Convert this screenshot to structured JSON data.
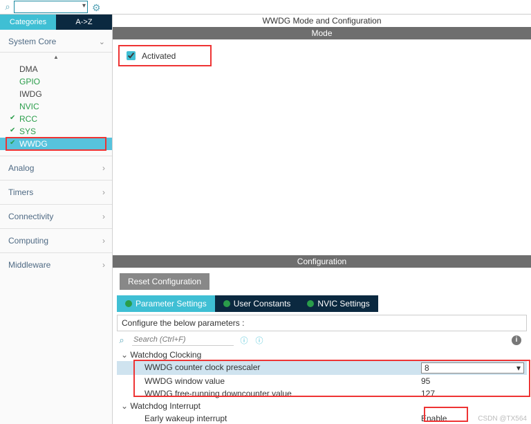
{
  "top": {
    "search_value": "",
    "search_placeholder": ""
  },
  "sidebar": {
    "tab_categories": "Categories",
    "tab_az": "A->Z",
    "system_core": {
      "label": "System Core",
      "items": [
        {
          "label": "DMA",
          "green": false,
          "checked": false
        },
        {
          "label": "GPIO",
          "green": true,
          "checked": false
        },
        {
          "label": "IWDG",
          "green": false,
          "checked": false
        },
        {
          "label": "NVIC",
          "green": true,
          "checked": false
        },
        {
          "label": "RCC",
          "green": true,
          "checked": true
        },
        {
          "label": "SYS",
          "green": true,
          "checked": true
        },
        {
          "label": "WWDG",
          "green": false,
          "checked": true,
          "selected": true
        }
      ]
    },
    "groups": [
      "Analog",
      "Timers",
      "Connectivity",
      "Computing",
      "Middleware"
    ]
  },
  "main": {
    "title": "WWDG Mode and Configuration",
    "mode_header": "Mode",
    "activated_label": "Activated",
    "activated_checked": true,
    "cfg_header": "Configuration",
    "reset_btn": "Reset Configuration",
    "subtabs": [
      "Parameter Settings",
      "User Constants",
      "NVIC Settings"
    ],
    "cfg_hint": "Configure the below parameters :",
    "cfg_search_placeholder": "Search (Ctrl+F)",
    "groups": [
      {
        "name": "Watchdog Clocking",
        "rows": [
          {
            "label": "WWDG counter clock prescaler",
            "value": "8",
            "selected": true
          },
          {
            "label": "WWDG window value",
            "value": "95"
          },
          {
            "label": "WWDG free-running downcounter value",
            "value": "127"
          }
        ]
      },
      {
        "name": "Watchdog Interrupt",
        "rows": [
          {
            "label": "Early wakeup interrupt",
            "value": "Enable"
          }
        ]
      }
    ]
  },
  "watermark": "CSDN @TX564"
}
